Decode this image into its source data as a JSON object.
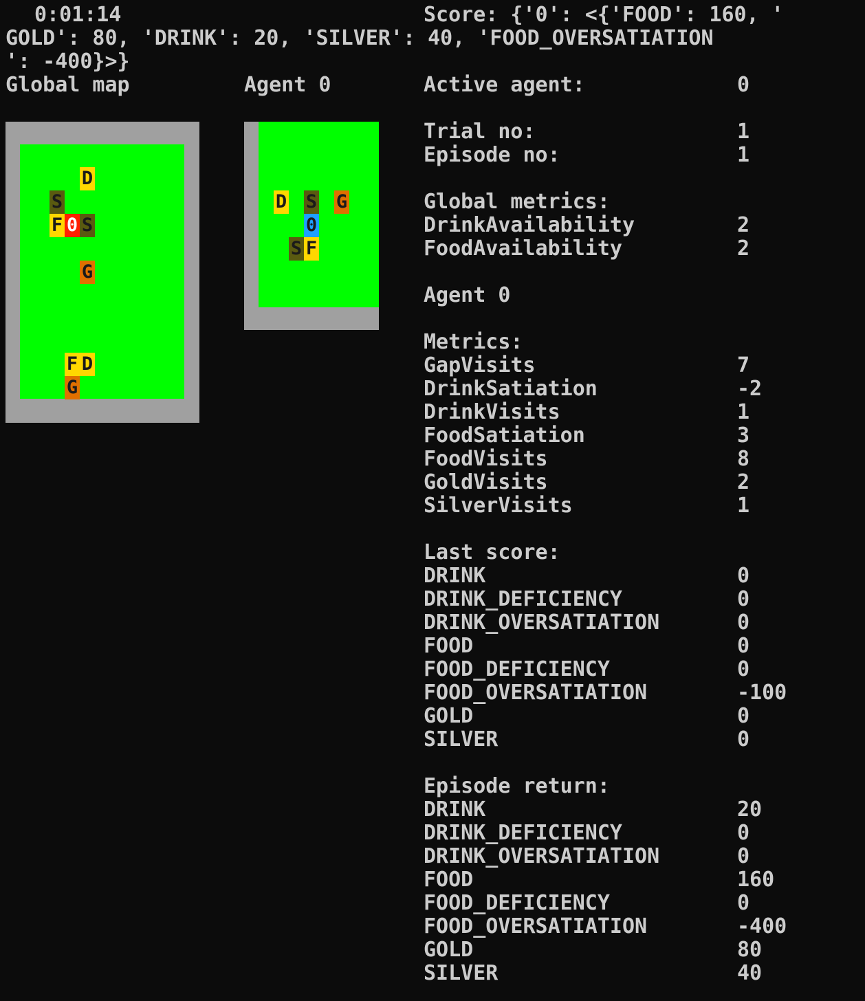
{
  "header": {
    "time": "0:01:14",
    "score_line1": "Score: {'0': <{'FOOD': 160, '",
    "score_line2": "GOLD': 80, 'DRINK': 20, 'SILVER': 40, 'FOOD_OVERSATIATION",
    "score_line3": "': -400}>}"
  },
  "titles": {
    "global_map": "Global map",
    "agent_view": "Agent 0"
  },
  "global_map_cells": [
    "D",
    "S",
    "F",
    "0",
    "S",
    "G",
    "F",
    "D",
    "G"
  ],
  "agent_map_cells": [
    "D",
    "S",
    "G",
    "0",
    "S",
    "F"
  ],
  "panel": {
    "active_agent_label": "Active agent:",
    "active_agent_value": "0",
    "trial_label": "Trial no:",
    "trial_value": "1",
    "episode_label": "Episode no:",
    "episode_value": "1",
    "global_metrics_label": "Global metrics:",
    "global_metrics": [
      {
        "name": "DrinkAvailability",
        "value": "2"
      },
      {
        "name": "FoodAvailability",
        "value": "2"
      }
    ],
    "agent_label": "Agent 0",
    "metrics_label": "Metrics:",
    "metrics": [
      {
        "name": "GapVisits",
        "value": "7"
      },
      {
        "name": "DrinkSatiation",
        "value": "-2"
      },
      {
        "name": "DrinkVisits",
        "value": "1"
      },
      {
        "name": "FoodSatiation",
        "value": "3"
      },
      {
        "name": "FoodVisits",
        "value": "8"
      },
      {
        "name": "GoldVisits",
        "value": "2"
      },
      {
        "name": "SilverVisits",
        "value": "1"
      }
    ],
    "last_score_label": "Last score:",
    "last_score": [
      {
        "name": "DRINK",
        "value": "0"
      },
      {
        "name": "DRINK_DEFICIENCY",
        "value": "0"
      },
      {
        "name": "DRINK_OVERSATIATION",
        "value": "0"
      },
      {
        "name": "FOOD",
        "value": "0"
      },
      {
        "name": "FOOD_DEFICIENCY",
        "value": "0"
      },
      {
        "name": "FOOD_OVERSATIATION",
        "value": "-100"
      },
      {
        "name": "GOLD",
        "value": "0"
      },
      {
        "name": "SILVER",
        "value": "0"
      }
    ],
    "episode_return_label": "Episode return:",
    "episode_return": [
      {
        "name": "DRINK",
        "value": "20"
      },
      {
        "name": "DRINK_DEFICIENCY",
        "value": "0"
      },
      {
        "name": "DRINK_OVERSATIATION",
        "value": "0"
      },
      {
        "name": "FOOD",
        "value": "160"
      },
      {
        "name": "FOOD_DEFICIENCY",
        "value": "0"
      },
      {
        "name": "FOOD_OVERSATIATION",
        "value": "-400"
      },
      {
        "name": "GOLD",
        "value": "80"
      },
      {
        "name": "SILVER",
        "value": "40"
      }
    ]
  },
  "colors": {
    "background": "#0c0c0c",
    "text": "#cccccc",
    "wall": "#a0a0a0",
    "grass": "#00ff00",
    "food_drink": "#ffd700",
    "silver": "#5a5a10",
    "gold": "#e07000",
    "agent_global": "#ff2000",
    "agent_local": "#1ea0ff"
  }
}
